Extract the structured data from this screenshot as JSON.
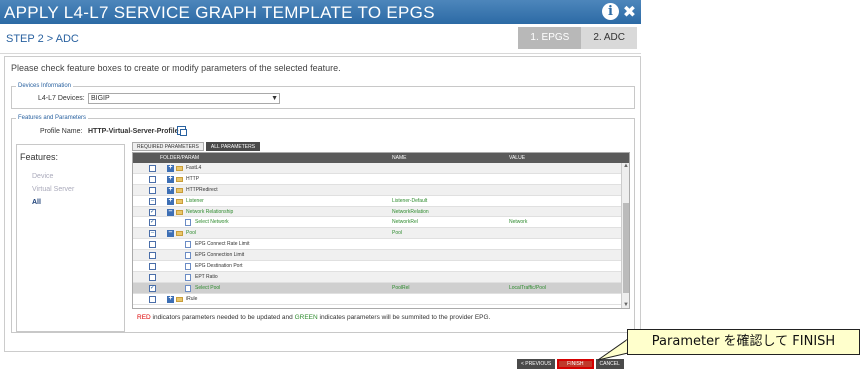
{
  "window": {
    "title": "APPLY L4-L7 SERVICE GRAPH TEMPLATE TO EPGS",
    "help_icon": "info-icon",
    "close_icon": "close-icon"
  },
  "step": {
    "title": "STEP 2 > ADC",
    "steps": [
      "1. EPGS",
      "2. ADC"
    ]
  },
  "instruction": "Please check feature boxes to create or modify parameters of the selected feature.",
  "devices": {
    "legend": "Devices Information",
    "label": "L4-L7 Devices:",
    "value": "BIGIP"
  },
  "features": {
    "legend": "Features and Parameters",
    "profile_label": "Profile Name:",
    "profile_value": "HTTP-Virtual-Server-Profile",
    "panel_title": "Features:",
    "list": [
      "Device",
      "Virtual Server",
      "All"
    ],
    "tabs": [
      "REQUIRED PARAMETERS",
      "ALL PARAMETERS"
    ],
    "columns": [
      "FOLDER/PARAM",
      "NAME",
      "VALUE"
    ],
    "rows": [
      {
        "label": "FastL4",
        "name": "",
        "value": ""
      },
      {
        "label": "HTTP",
        "name": "",
        "value": ""
      },
      {
        "label": "HTTPRedirect",
        "name": "",
        "value": ""
      },
      {
        "label": "Listener",
        "name": "Listener-Default",
        "value": ""
      },
      {
        "label": "Network Relationship",
        "name": "NetworkRelation",
        "value": ""
      },
      {
        "label": "Select Network",
        "name": "NetworkRel",
        "value": "Network"
      },
      {
        "label": "Pool",
        "name": "Pool",
        "value": ""
      },
      {
        "label": "EPG Connect Rate Limit",
        "name": "",
        "value": ""
      },
      {
        "label": "EPG Connection Limit",
        "name": "",
        "value": ""
      },
      {
        "label": "EPG Destination Port",
        "name": "",
        "value": ""
      },
      {
        "label": "EPT Ratio",
        "name": "",
        "value": ""
      },
      {
        "label": "Select Pool",
        "name": "PoolRel",
        "value": "LocalTraffic/Pool"
      },
      {
        "label": "iRule",
        "name": "",
        "value": ""
      }
    ]
  },
  "note": {
    "red": "RED",
    "mid": " indicators parameters needed to be updated and ",
    "green": "GREEN",
    "end": " indicates parameters will be summited to the provider EPG."
  },
  "buttons": {
    "previous": "< PREVIOUS",
    "finish": "FINISH",
    "cancel": "CANCEL"
  },
  "callout": "Parameter を確認して FINISH",
  "colors": {
    "title_bar": "#2c6aa5",
    "green_text": "#2e8b2e",
    "red_text": "#d00000",
    "callout_bg": "#ffffcc"
  }
}
